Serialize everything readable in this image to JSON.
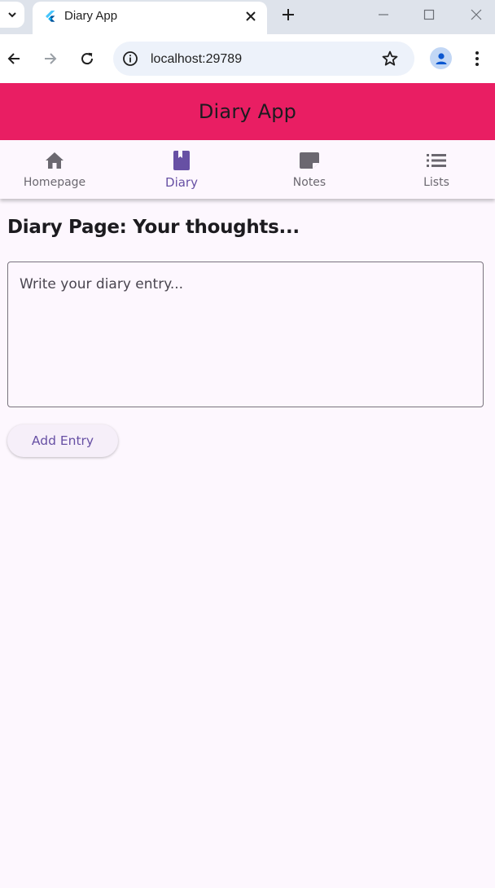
{
  "browser": {
    "tab_title": "Diary App",
    "url": "localhost:29789"
  },
  "app": {
    "title": "Diary App"
  },
  "nav_tabs": [
    {
      "label": "Homepage",
      "icon": "home-icon",
      "active": false
    },
    {
      "label": "Diary",
      "icon": "book-icon",
      "active": true
    },
    {
      "label": "Notes",
      "icon": "note-icon",
      "active": false
    },
    {
      "label": "Lists",
      "icon": "list-icon",
      "active": false
    }
  ],
  "diary": {
    "page_title": "Diary Page: Your thoughts...",
    "entry_placeholder": "Write your diary entry...",
    "entry_value": "",
    "add_button_label": "Add Entry"
  },
  "colors": {
    "appbar": "#e91e63",
    "accent": "#6750a4",
    "background": "#fdf7fe"
  }
}
